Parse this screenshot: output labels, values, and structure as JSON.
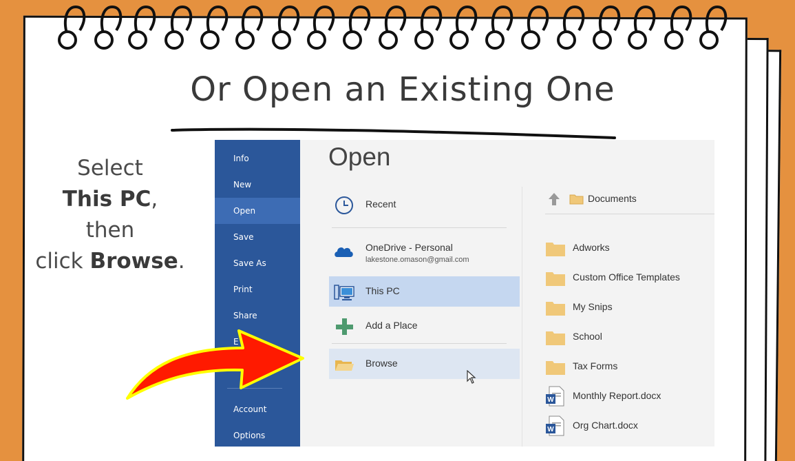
{
  "slide": {
    "title": "Or Open an Existing One",
    "instruction": {
      "line1": "Select",
      "line2_bold": "This PC",
      "line2_tail": ",",
      "line3": "then",
      "line4_pre": "click ",
      "line4_bold": "Browse",
      "line4_tail": "."
    }
  },
  "word": {
    "sidebar": {
      "items": [
        {
          "label": "Info"
        },
        {
          "label": "New"
        },
        {
          "label": "Open"
        },
        {
          "label": "Save"
        },
        {
          "label": "Save As"
        },
        {
          "label": "Print"
        },
        {
          "label": "Share"
        },
        {
          "label": "E"
        },
        {
          "label": "Account"
        },
        {
          "label": "Options"
        }
      ],
      "active": "Open"
    },
    "heading": "Open",
    "places": {
      "recent": "Recent",
      "onedrive_name": "OneDrive - Personal",
      "onedrive_email": "lakestone.omason@gmail.com",
      "this_pc": "This PC",
      "add_place": "Add a Place",
      "browse": "Browse"
    },
    "location": "Documents",
    "files": [
      {
        "name": "Adworks",
        "type": "folder"
      },
      {
        "name": "Custom Office Templates",
        "type": "folder"
      },
      {
        "name": "My Snips",
        "type": "folder"
      },
      {
        "name": "School",
        "type": "folder"
      },
      {
        "name": "Tax Forms",
        "type": "folder"
      },
      {
        "name": "Monthly Report.docx",
        "type": "docx"
      },
      {
        "name": "Org Chart.docx",
        "type": "docx"
      }
    ]
  },
  "colors": {
    "background": "#e5913f",
    "sidebar": "#2b579a",
    "selected": "#c5d7f0",
    "arrow": "#ff1a00",
    "arrow_outline": "#ffff00",
    "folder": "#f0c879"
  }
}
